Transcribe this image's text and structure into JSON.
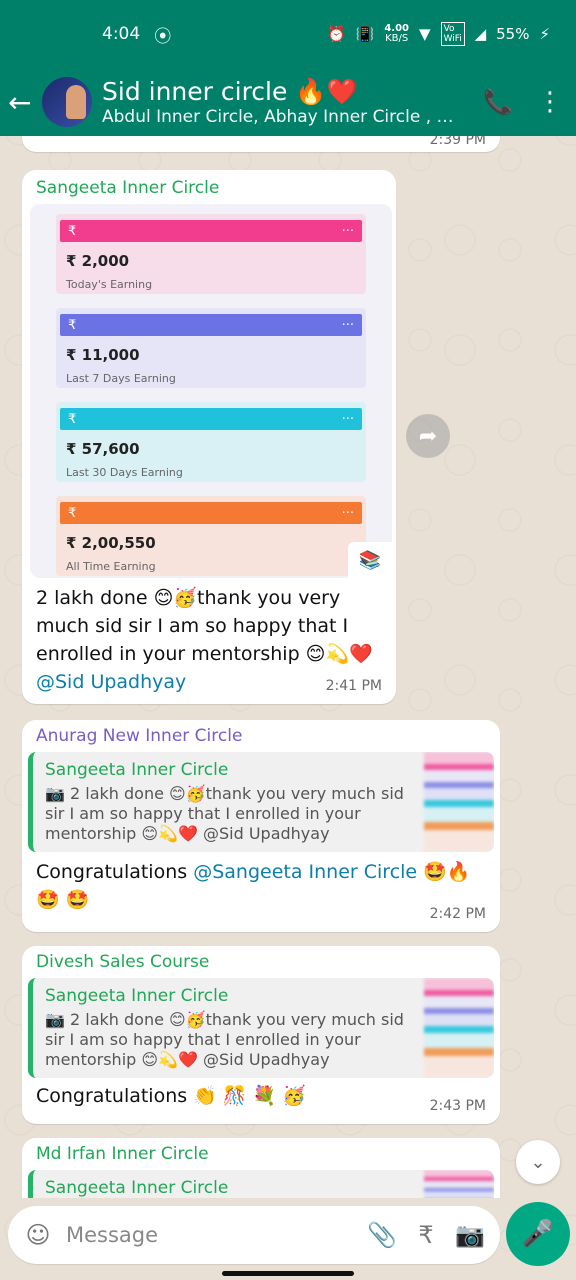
{
  "status": {
    "time": "4:04",
    "data_rate_top": "4.00",
    "data_rate_bottom": "KB/S",
    "vowifi": "Vo WiFi",
    "battery": "55%"
  },
  "header": {
    "title": "Sid inner circle 🔥❤️",
    "subtitle": "Abdul Inner Circle, Abhay Inner Circle , Abh…"
  },
  "messages": [
    {
      "sender": "Sangeeta  Inner Circle",
      "sender_color": "#1fa855",
      "image": {
        "cards": [
          {
            "amount": "₹ 2,000",
            "label": "Today's Earning",
            "bar_color": "#f23d8f",
            "bg": "#f7dcea"
          },
          {
            "amount": "₹ 11,000",
            "label": "Last 7 Days Earning",
            "bar_color": "#6b72e3",
            "bg": "#e5e5f7"
          },
          {
            "amount": "₹ 57,600",
            "label": "Last 30 Days Earning",
            "bar_color": "#1fc2da",
            "bg": "#d9f0f4"
          },
          {
            "amount": "₹ 2,00,550",
            "label": "All Time Earning",
            "bar_color": "#f47a34",
            "bg": "#f8e3dc"
          }
        ]
      },
      "text": "2 lakh done 😊🥳thank you very much sid sir I am so happy that I enrolled in your mentorship 😊💫❤️",
      "mention": "@Sid Upadhyay",
      "time": "2:41 PM"
    },
    {
      "sender": "Anurag New Inner Circle",
      "sender_color": "#7a5cc7",
      "quote_name": "Sangeeta  Inner Circle",
      "quote_text": "📷 2 lakh done 😊🥳thank you very much sid sir I am so happy that I enrolled in your mentorship 😊💫❤️ @Sid Upadhyay",
      "text_prefix": "Congratulations ",
      "mention": "@Sangeeta  Inner Circle",
      "text_suffix": " 🤩🔥🤩 🤩",
      "time": "2:42 PM"
    },
    {
      "sender": "Divesh Sales Course",
      "sender_color": "#1fa855",
      "quote_name": "Sangeeta  Inner Circle",
      "quote_text": "📷 2 lakh done 😊🥳thank you very much sid sir I am so happy that I enrolled in your mentorship 😊💫❤️ @Sid Upadhyay",
      "text": "Congratulations 👏 🎊 💐 🥳",
      "time": "2:43 PM"
    },
    {
      "sender": "Md Irfan Inner Circle",
      "sender_color": "#1fa855",
      "quote_name": "Sangeeta  Inner Circle"
    }
  ],
  "previous_time": "2:39 PM",
  "composer": {
    "placeholder": "Message"
  }
}
